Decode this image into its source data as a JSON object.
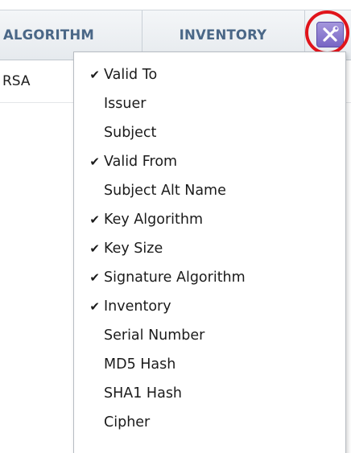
{
  "table": {
    "columns": [
      {
        "label": "ALGORITHM"
      },
      {
        "label": "INVENTORY"
      }
    ],
    "rows": [
      {
        "algorithm": "RSA"
      }
    ]
  },
  "settings_button": {
    "icon": "wrench-screwdriver-icon",
    "color": "#8473cf",
    "highlight_color": "#e0141b"
  },
  "column_menu": {
    "items": [
      {
        "label": "Valid To",
        "checked": true,
        "check_glyph": "✔"
      },
      {
        "label": "Issuer",
        "checked": false,
        "check_glyph": ""
      },
      {
        "label": "Subject",
        "checked": false,
        "check_glyph": ""
      },
      {
        "label": "Valid From",
        "checked": true,
        "check_glyph": "✔"
      },
      {
        "label": "Subject Alt Name",
        "checked": false,
        "check_glyph": ""
      },
      {
        "label": "Key Algorithm",
        "checked": true,
        "check_glyph": "✔"
      },
      {
        "label": "Key Size",
        "checked": true,
        "check_glyph": "✔"
      },
      {
        "label": "Signature Algorithm",
        "checked": true,
        "check_glyph": "✔"
      },
      {
        "label": "Inventory",
        "checked": true,
        "check_glyph": "✔"
      },
      {
        "label": "Serial Number",
        "checked": false,
        "check_glyph": ""
      },
      {
        "label": "MD5 Hash",
        "checked": false,
        "check_glyph": ""
      },
      {
        "label": "SHA1 Hash",
        "checked": false,
        "check_glyph": ""
      },
      {
        "label": "Cipher",
        "checked": false,
        "check_glyph": ""
      }
    ]
  }
}
